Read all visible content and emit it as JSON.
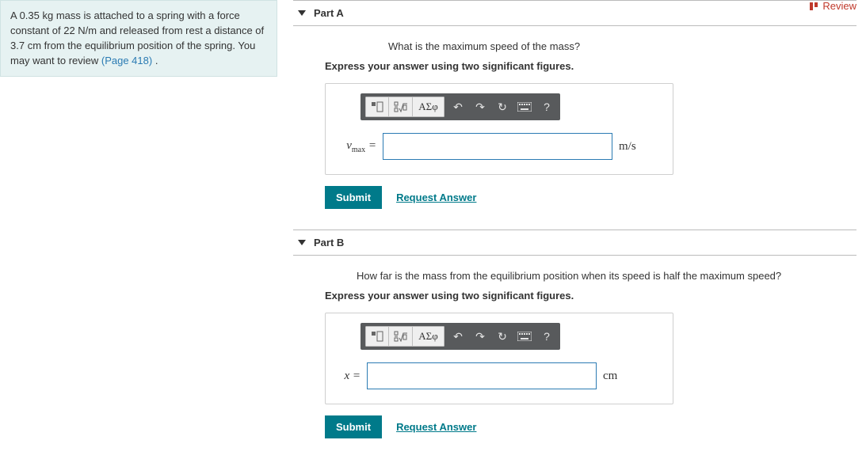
{
  "review": {
    "label": "Review"
  },
  "problem": {
    "text_prefix": "A 0.35 ",
    "unit_kg": "kg",
    "text_mid1": " mass is attached to a spring with a force constant of 22 ",
    "unit_nm": "N/m",
    "text_mid2": " and released from rest a distance of 3.7 ",
    "unit_cm": "cm",
    "text_mid3": " from the equilibrium position of the spring. You may want to review ",
    "page_link": "(Page 418)",
    "text_end": " ."
  },
  "parts": {
    "a": {
      "title": "Part A",
      "question": "What is the maximum speed of the mass?",
      "instruction": "Express your answer using two significant figures.",
      "toolbar": {
        "greek": "ΑΣφ",
        "help": "?"
      },
      "var": "v",
      "sub": "max",
      "eq": " = ",
      "unit": "m/s",
      "submit": "Submit",
      "request": "Request Answer"
    },
    "b": {
      "title": "Part B",
      "question": "How far is the mass from the equilibrium position when its speed is half the maximum speed?",
      "instruction": "Express your answer using two significant figures.",
      "toolbar": {
        "greek": "ΑΣφ",
        "help": "?"
      },
      "var": "x",
      "eq": " = ",
      "unit": "cm",
      "submit": "Submit",
      "request": "Request Answer"
    }
  }
}
